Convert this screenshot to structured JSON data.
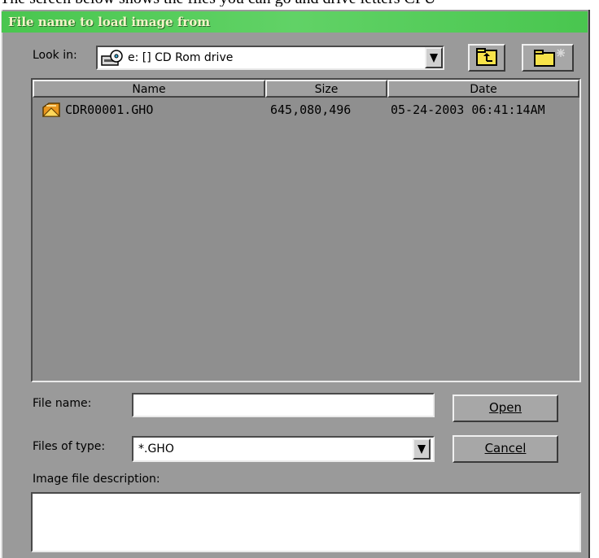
{
  "page_top_text": "The screen below shows the files you can go and drive letters CPU",
  "dialog": {
    "title": "File name to load image from",
    "look_in_label": "Look in:",
    "look_in_value": "e: [] CD Rom drive",
    "columns": [
      "Name",
      "Size",
      "Date"
    ],
    "files": [
      {
        "name": "CDR00001.GHO",
        "size": "645,080,496",
        "date": "05-24-2003 06:41:14AM"
      }
    ],
    "file_name_label": "File name:",
    "file_name_value": "",
    "files_of_type_label": "Files of type:",
    "files_of_type_value": "*.GHO",
    "open_label": "Open",
    "cancel_label": "Cancel",
    "description_label": "Image file description:",
    "description_value": ""
  },
  "colors": {
    "title_bar": "#49c64f",
    "dialog_bg": "#9a9a9a",
    "list_bg": "#8f8f8f",
    "folder_icon": "#f7e34a"
  },
  "icons": [
    "cd-drive-icon",
    "dropdown-arrow-icon",
    "up-folder-icon",
    "new-folder-icon",
    "file-icon"
  ]
}
